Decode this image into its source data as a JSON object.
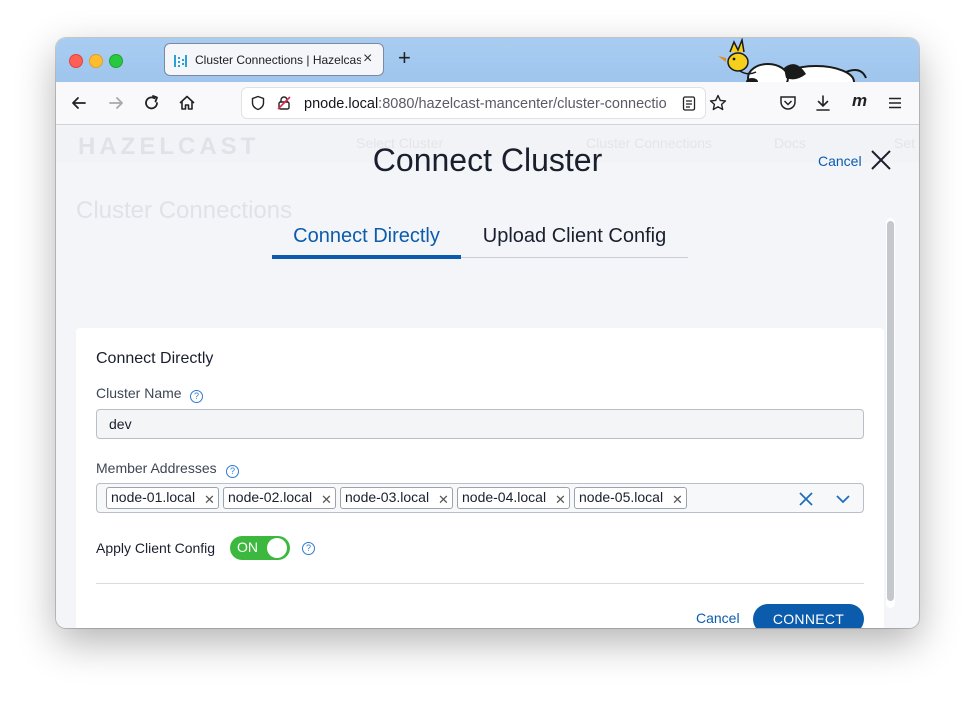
{
  "browser": {
    "tab_title": "Cluster Connections | Hazelcast",
    "tab_close": "×",
    "new_tab": "+",
    "url_host": "pnode.local",
    "url_rest": ":8080/hazelcast-mancenter/cluster-connectio",
    "account_icon": "m"
  },
  "background": {
    "logo": "HAZELCAST",
    "select_cluster": "Select Cluster",
    "cluster_connections": "Cluster Connections",
    "docs": "Docs",
    "settings": "Set",
    "heading": "Cluster Connections"
  },
  "dialog": {
    "title": "Connect Cluster",
    "cancel_label": "Cancel",
    "tabs": [
      {
        "label": "Connect Directly",
        "active": true
      },
      {
        "label": "Upload Client Config",
        "active": false
      }
    ],
    "section_title": "Connect Directly",
    "cluster_name_label": "Cluster Name",
    "cluster_name_value": "dev",
    "member_addresses_label": "Member Addresses",
    "members": [
      "node-01.local",
      "node-02.local",
      "node-03.local",
      "node-04.local",
      "node-05.local"
    ],
    "apply_client_config_label": "Apply Client Config",
    "apply_client_config_state": "ON",
    "help_glyph": "?",
    "footer_cancel": "Cancel",
    "connect_button": "CONNECT"
  },
  "colors": {
    "accent": "#0b5cad",
    "toggle_on": "#3cb83e"
  }
}
